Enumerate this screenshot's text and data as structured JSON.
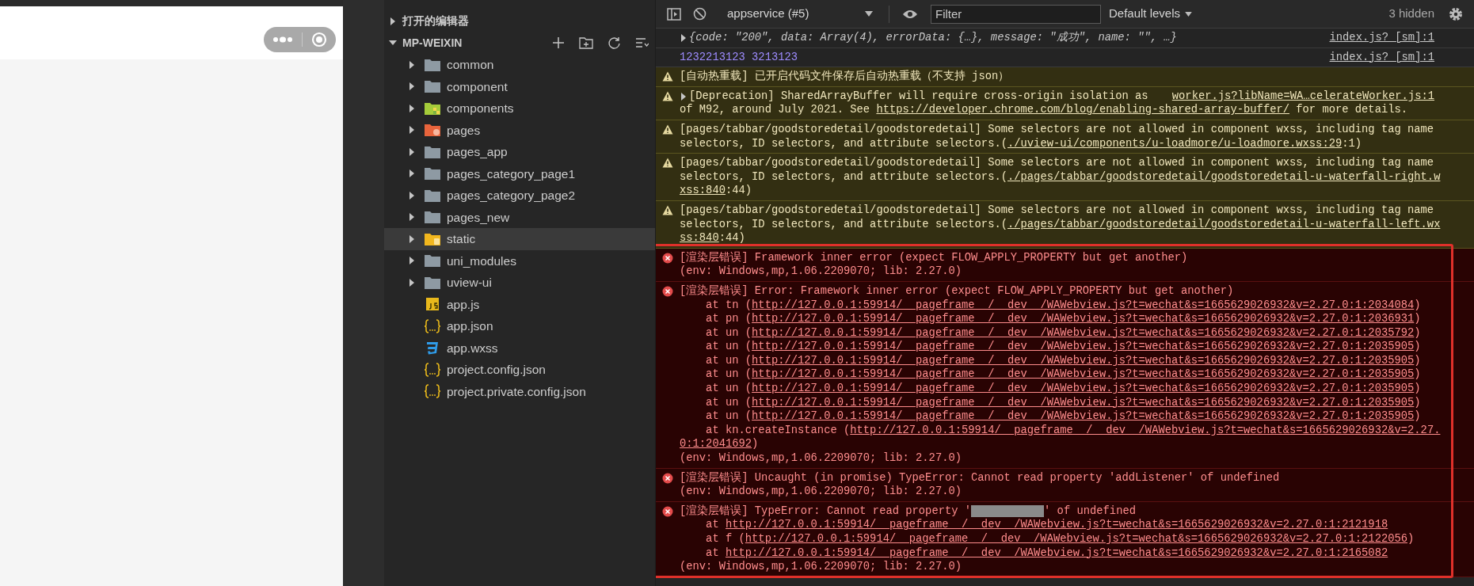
{
  "file_tree": {
    "sections": [
      {
        "label": "打开的编辑器",
        "expanded": false
      },
      {
        "label": "MP-WEIXIN",
        "expanded": true,
        "children": [
          {
            "label": "common",
            "kind": "folder",
            "expanded": false,
            "selected": false
          },
          {
            "label": "component",
            "kind": "folder",
            "expanded": false,
            "selected": false
          },
          {
            "label": "components",
            "kind": "component-folder",
            "expanded": false,
            "selected": false
          },
          {
            "label": "pages",
            "kind": "page-folder",
            "expanded": false,
            "selected": false
          },
          {
            "label": "pages_app",
            "kind": "folder",
            "expanded": false,
            "selected": false
          },
          {
            "label": "pages_category_page1",
            "kind": "folder",
            "expanded": false,
            "selected": false
          },
          {
            "label": "pages_category_page2",
            "kind": "folder",
            "expanded": false,
            "selected": false
          },
          {
            "label": "pages_new",
            "kind": "folder",
            "expanded": false,
            "selected": false
          },
          {
            "label": "static",
            "kind": "static-folder",
            "expanded": false,
            "selected": true
          },
          {
            "label": "uni_modules",
            "kind": "folder",
            "expanded": false,
            "selected": false
          },
          {
            "label": "uview-ui",
            "kind": "folder",
            "expanded": false,
            "selected": false
          },
          {
            "label": "app.js",
            "kind": "script",
            "selected": false
          },
          {
            "label": "app.json",
            "kind": "config",
            "selected": false
          },
          {
            "label": "app.wxss",
            "kind": "style",
            "selected": false
          },
          {
            "label": "project.config.json",
            "kind": "config",
            "selected": false
          },
          {
            "label": "project.private.config.json",
            "kind": "config",
            "selected": false
          }
        ]
      }
    ]
  },
  "console": {
    "toolbar": {
      "context": "appservice (#5)",
      "filter_placeholder": "Filter",
      "levels": "Default levels",
      "hidden_count": "3 hidden"
    },
    "messages": [
      {
        "kind": "object",
        "expanded": false,
        "source": "index.js? [sm]:1",
        "lines": [
          [
            "{code: \"200\", data: Array(4), errorData: {…}, message: \"成功\", name: \"\", …}"
          ]
        ]
      },
      {
        "kind": "number",
        "source": "index.js? [sm]:1",
        "lines": [
          [
            "1232213123 3213123"
          ]
        ]
      },
      {
        "kind": "warning",
        "lines": [
          [
            "[自动热重载] 已开启代码文件保存后自动热重载（不支持 json）"
          ]
        ]
      },
      {
        "kind": "warning",
        "expanded": false,
        "source": "worker.js?libName=WA…celerateWorker.js:1",
        "lines": [
          [
            "[Deprecation] SharedArrayBuffer will require cross-origin isolation as"
          ],
          [
            "of M92, around July 2021. See ",
            {
              "link": "https://developer.chrome.com/blog/enabling-shared-array-buffer/"
            },
            " for more details."
          ]
        ]
      },
      {
        "kind": "warning",
        "lines": [
          [
            "[pages/tabbar/goodstoredetail/goodstoredetail] Some selectors are not allowed in component wxss, including tag name"
          ],
          [
            "selectors, ID selectors, and attribute selectors.(",
            {
              "link": "./uview-ui/components/u-loadmore/u-loadmore.wxss:29"
            },
            ":1)"
          ]
        ]
      },
      {
        "kind": "warning",
        "lines": [
          [
            "[pages/tabbar/goodstoredetail/goodstoredetail] Some selectors are not allowed in component wxss, including tag name"
          ],
          [
            "selectors, ID selectors, and attribute selectors.(",
            {
              "link": "./pages/tabbar/goodstoredetail/goodstoredetail-u-waterfall-right.w"
            }
          ],
          [
            {
              "link": "xss:840"
            },
            ":44)"
          ]
        ]
      },
      {
        "kind": "warning",
        "lines": [
          [
            "[pages/tabbar/goodstoredetail/goodstoredetail] Some selectors are not allowed in component wxss, including tag name"
          ],
          [
            "selectors, ID selectors, and attribute selectors.(",
            {
              "link": "./pages/tabbar/goodstoredetail/goodstoredetail-u-waterfall-left.wx"
            }
          ],
          [
            {
              "link": "ss:840"
            },
            ":44)"
          ]
        ]
      },
      {
        "kind": "error",
        "lines": [
          [
            "[渲染层错误] Framework inner error (expect FLOW_APPLY_PROPERTY but get another)"
          ],
          [
            "(env: Windows,mp,1.06.2209070; lib: 2.27.0)"
          ]
        ]
      },
      {
        "kind": "error",
        "lines": [
          [
            "[渲染层错误] Error: Framework inner error (expect FLOW_APPLY_PROPERTY but get another)"
          ],
          [
            "    at tn (",
            {
              "link": "http://127.0.0.1:59914/__pageframe__/__dev__/WAWebview.js?t=wechat&s=1665629026932&v=2.27.0:1:2034084"
            },
            ")"
          ],
          [
            "    at pn (",
            {
              "link": "http://127.0.0.1:59914/__pageframe__/__dev__/WAWebview.js?t=wechat&s=1665629026932&v=2.27.0:1:2036931"
            },
            ")"
          ],
          [
            "    at un (",
            {
              "link": "http://127.0.0.1:59914/__pageframe__/__dev__/WAWebview.js?t=wechat&s=1665629026932&v=2.27.0:1:2035792"
            },
            ")"
          ],
          [
            "    at un (",
            {
              "link": "http://127.0.0.1:59914/__pageframe__/__dev__/WAWebview.js?t=wechat&s=1665629026932&v=2.27.0:1:2035905"
            },
            ")"
          ],
          [
            "    at un (",
            {
              "link": "http://127.0.0.1:59914/__pageframe__/__dev__/WAWebview.js?t=wechat&s=1665629026932&v=2.27.0:1:2035905"
            },
            ")"
          ],
          [
            "    at un (",
            {
              "link": "http://127.0.0.1:59914/__pageframe__/__dev__/WAWebview.js?t=wechat&s=1665629026932&v=2.27.0:1:2035905"
            },
            ")"
          ],
          [
            "    at un (",
            {
              "link": "http://127.0.0.1:59914/__pageframe__/__dev__/WAWebview.js?t=wechat&s=1665629026932&v=2.27.0:1:2035905"
            },
            ")"
          ],
          [
            "    at un (",
            {
              "link": "http://127.0.0.1:59914/__pageframe__/__dev__/WAWebview.js?t=wechat&s=1665629026932&v=2.27.0:1:2035905"
            },
            ")"
          ],
          [
            "    at un (",
            {
              "link": "http://127.0.0.1:59914/__pageframe__/__dev__/WAWebview.js?t=wechat&s=1665629026932&v=2.27.0:1:2035905"
            },
            ")"
          ],
          [
            "    at kn.createInstance (",
            {
              "link": "http://127.0.0.1:59914/__pageframe__/__dev__/WAWebview.js?t=wechat&s=1665629026932&v=2.27."
            }
          ],
          [
            {
              "link": "0:1:2041692"
            },
            ")"
          ],
          [
            "(env: Windows,mp,1.06.2209070; lib: 2.27.0)"
          ]
        ]
      },
      {
        "kind": "error",
        "lines": [
          [
            "[渲染层错误] Uncaught (in promise) TypeError: Cannot read property 'addListener' of undefined"
          ],
          [
            "(env: Windows,mp,1.06.2209070; lib: 2.27.0)"
          ]
        ]
      },
      {
        "kind": "error",
        "lines": [
          [
            "[渲染层错误] TypeError: Cannot read property '",
            {
              "kind": "redacted"
            },
            "' of undefined"
          ],
          [
            "    at ",
            {
              "link": "http://127.0.0.1:59914/__pageframe__/__dev__/WAWebview.js?t=wechat&s=1665629026932&v=2.27.0:1:2121918"
            }
          ],
          [
            "    at f (",
            {
              "link": "http://127.0.0.1:59914/__pageframe__/__dev__/WAWebview.js?t=wechat&s=1665629026932&v=2.27.0:1:2122056"
            },
            ")"
          ],
          [
            "    at ",
            {
              "link": "http://127.0.0.1:59914/__pageframe__/__dev__/WAWebview.js?t=wechat&s=1665629026932&v=2.27.0:1:2165082"
            }
          ],
          [
            "(env: Windows,mp,1.06.2209070; lib: 2.27.0)"
          ]
        ]
      }
    ]
  }
}
